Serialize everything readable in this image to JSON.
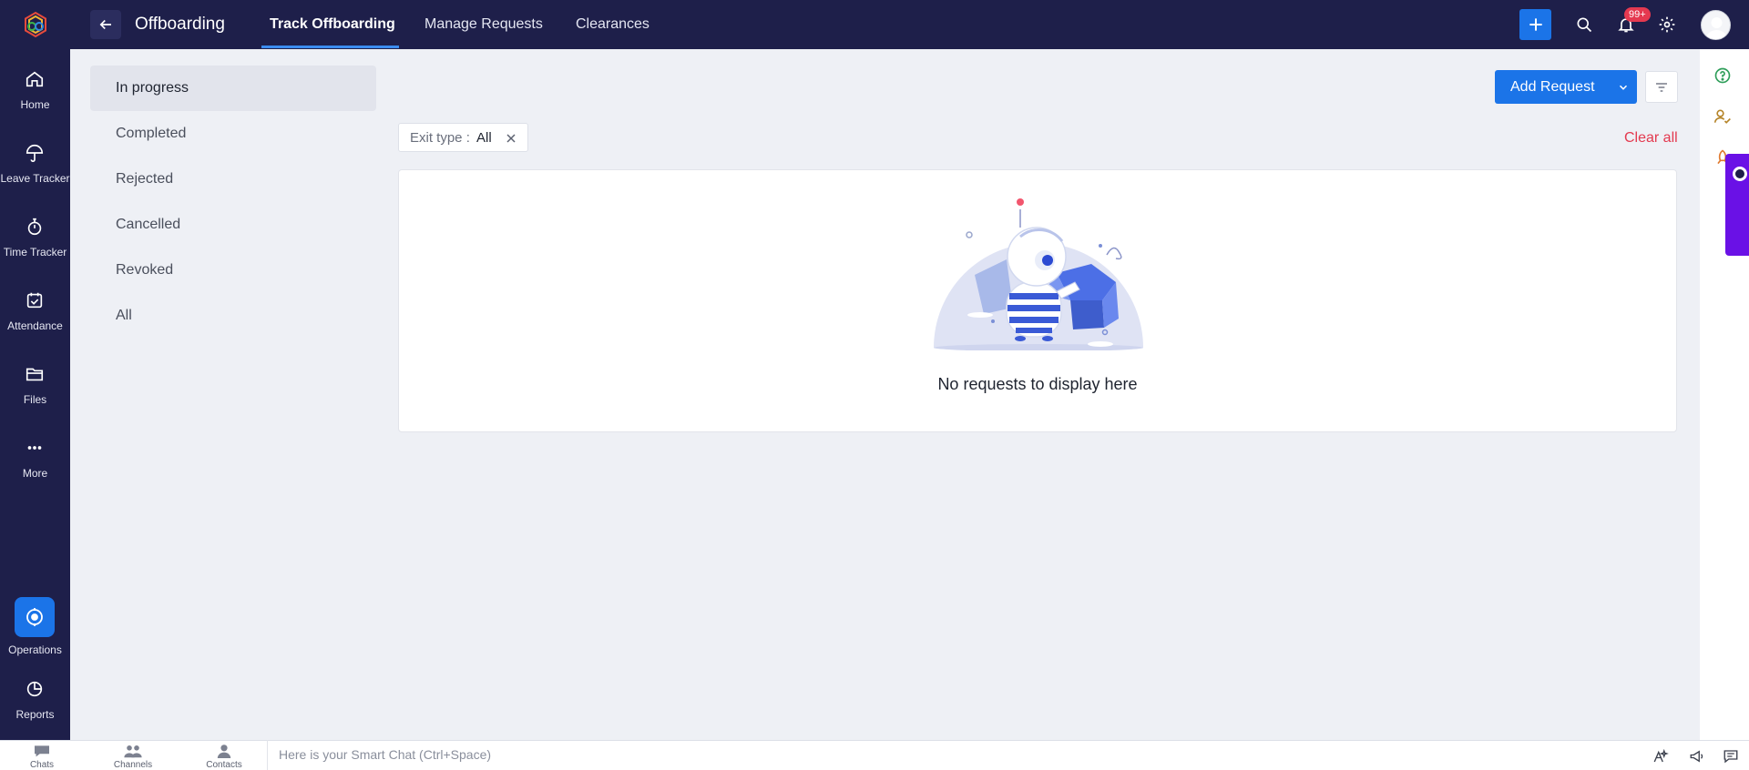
{
  "app": {
    "module_title": "Offboarding",
    "tabs": [
      {
        "label": "Track Offboarding",
        "active": true
      },
      {
        "label": "Manage Requests",
        "active": false
      },
      {
        "label": "Clearances",
        "active": false
      }
    ],
    "notification_badge": "99+"
  },
  "leftnav": {
    "items": [
      {
        "label": "Home",
        "icon": "home-icon"
      },
      {
        "label": "Leave Tracker",
        "icon": "umbrella-icon"
      },
      {
        "label": "Time Tracker",
        "icon": "stopwatch-icon"
      },
      {
        "label": "Attendance",
        "icon": "calendar-check-icon"
      },
      {
        "label": "Files",
        "icon": "folder-icon"
      },
      {
        "label": "More",
        "icon": "more-icon"
      },
      {
        "label": "Operations",
        "icon": "operations-icon",
        "active": true
      },
      {
        "label": "Reports",
        "icon": "pie-chart-icon"
      }
    ]
  },
  "status_filters": [
    {
      "label": "In progress",
      "active": true
    },
    {
      "label": "Completed"
    },
    {
      "label": "Rejected"
    },
    {
      "label": "Cancelled"
    },
    {
      "label": "Revoked"
    },
    {
      "label": "All"
    }
  ],
  "toolbar": {
    "add_request_label": "Add Request",
    "chip_key": "Exit type :",
    "chip_value": "All",
    "clear_all_label": "Clear all"
  },
  "content": {
    "empty_message": "No requests to display here"
  },
  "bottombar": {
    "items": [
      {
        "label": "Chats"
      },
      {
        "label": "Channels"
      },
      {
        "label": "Contacts"
      }
    ],
    "smartchat_placeholder": "Here is your Smart Chat (Ctrl+Space)"
  },
  "colors": {
    "nav_bg": "#1e1f4a",
    "accent": "#1b74e8",
    "danger": "#e3394f",
    "page_bg": "#eef0f5"
  }
}
